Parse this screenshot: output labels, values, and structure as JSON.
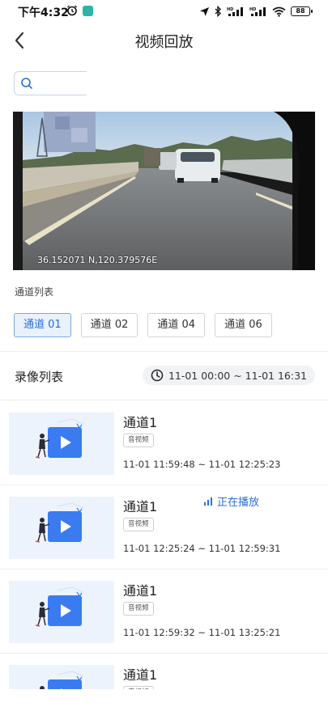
{
  "status_bar": {
    "time": "下午4:32",
    "battery": "88",
    "icons": [
      "alarm-icon",
      "app-icon",
      "location-icon",
      "bluetooth-icon",
      "signal-hd-icon",
      "signal-hd-icon",
      "wifi-icon",
      "battery-icon"
    ]
  },
  "header": {
    "title": "视频回放",
    "back_icon": "chevron-left-icon"
  },
  "search": {
    "icon": "search-icon",
    "placeholder": ""
  },
  "video": {
    "coordinates": "36.152071 N,120.379576E"
  },
  "channel_section": {
    "label": "通道列表",
    "channels": [
      {
        "label": "通道 01",
        "active": true
      },
      {
        "label": "通道 02",
        "active": false
      },
      {
        "label": "通道 04",
        "active": false
      },
      {
        "label": "通道 06",
        "active": false
      }
    ]
  },
  "recording_section": {
    "title": "录像列表",
    "time_range": "11-01 00:00 ~ 11-01 16:31",
    "clock_icon": "clock-icon"
  },
  "records": [
    {
      "name": "通道1",
      "tag": "音视频",
      "time": "11-01 11:59:48 ~ 11-01 12:25:23",
      "playing": ""
    },
    {
      "name": "通道1",
      "tag": "音视频",
      "time": "11-01 12:25:24 ~ 11-01 12:59:31",
      "playing": "正在播放"
    },
    {
      "name": "通道1",
      "tag": "音视频",
      "time": "11-01 12:59:32 ~ 11-01 13:25:21",
      "playing": ""
    },
    {
      "name": "通道1",
      "tag": "音视频",
      "time": "",
      "playing": ""
    }
  ],
  "colors": {
    "accent": "#2a6fd6",
    "play_button": "#3a7bf0",
    "thumb_bg": "#edf3fc"
  }
}
